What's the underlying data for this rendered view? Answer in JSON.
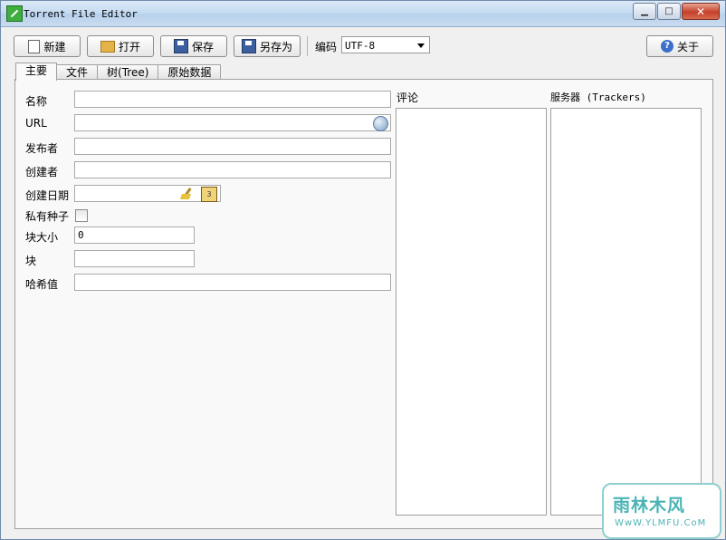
{
  "window": {
    "title": "Torrent File Editor"
  },
  "toolbar": {
    "new_label": "新建",
    "open_label": "打开",
    "save_label": "保存",
    "save_as_label": "另存为",
    "encoding_label": "编码",
    "encoding_value": "UTF-8",
    "about_label": "关于"
  },
  "tabs": [
    {
      "label": "主要"
    },
    {
      "label": "文件"
    },
    {
      "label": "树(Tree)"
    },
    {
      "label": "原始数据"
    }
  ],
  "form": {
    "name_label": "名称",
    "url_label": "URL",
    "publisher_label": "发布者",
    "creator_label": "创建者",
    "created_date_label": "创建日期",
    "private_label": "私有种子",
    "piece_size_label": "块大小",
    "piece_size_value": "0",
    "pieces_label": "块",
    "hash_label": "哈希值"
  },
  "comments_label": "评论",
  "trackers_label": "服务器 (Trackers)",
  "watermark": {
    "main": "雨林木风",
    "sub": "WwW.YLMFU.CoM"
  }
}
